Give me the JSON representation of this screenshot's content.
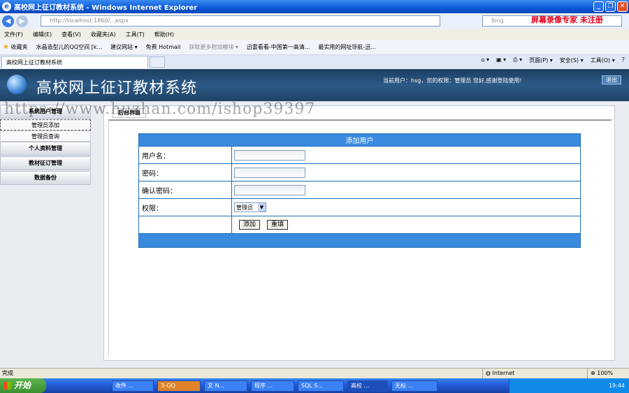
{
  "window": {
    "title": "高校网上征订教材系统 - Windows Internet Explorer",
    "minimize": "_",
    "restore": "❐",
    "close": "✕"
  },
  "address": {
    "url": "http://localhost:1860/...aspx",
    "search_placeholder": "Bing",
    "recorder_text": "屏幕录像专家 未注册"
  },
  "menu": [
    "文件(F)",
    "编辑(E)",
    "查看(V)",
    "收藏夹(A)",
    "工具(T)",
    "帮助(H)"
  ],
  "favorites": {
    "label": "收藏夹",
    "items": [
      "水晶造型儿的QQ空间 [k...",
      "建议网站 ▾",
      "免费 Hotmail",
      "获取更多附加模块 ▾",
      "迅雷看看-中国第一高清...",
      "最实用的网址导航-迅..."
    ]
  },
  "tab": {
    "label": "高校网上征订教材系统"
  },
  "command_bar": [
    "页面(P) ▾",
    "安全(S) ▾",
    "工具(O) ▾"
  ],
  "app": {
    "title": "高校网上征订教材系统",
    "user_info": "当前用户：hsg，您的权限：管理员 您好,感谢登陆使用!",
    "logout": "退出",
    "watermark": "https://www.huzhan.com/ishop39397"
  },
  "sidebar": {
    "section1": "系统用户管理",
    "items": [
      "管理员添加",
      "管理员查询"
    ],
    "section2": "个人资料管理",
    "section3": "教材征订管理",
    "section4": "数据备份"
  },
  "main": {
    "tab_label": "后台界面"
  },
  "form": {
    "header": "添加用户",
    "username_label": "用户名：",
    "password_label": "密码：",
    "confirm_label": "确认密码：",
    "role_label": "权限：",
    "role_value": "管理员",
    "add_button": "添加",
    "reset_button": "重填"
  },
  "status": {
    "left": "完成",
    "zone": "Internet",
    "zoom": "100%"
  },
  "taskbar": {
    "start": "开始",
    "items": [
      "收件 ...",
      "3-QQ",
      "文 N...",
      "程序 ...",
      "SQL S...",
      "高校 ...",
      "无标 ..."
    ],
    "clock": "19:44"
  }
}
